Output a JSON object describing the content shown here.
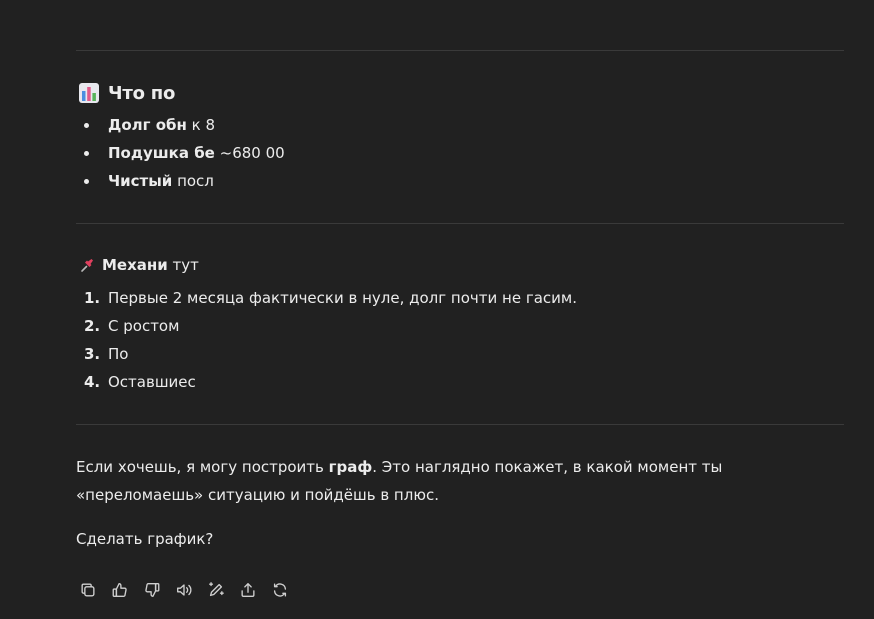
{
  "section1": {
    "heading_icon": "bar-chart-emoji-icon",
    "heading": "Что по",
    "items": [
      {
        "bold": "Долг обн",
        "text": " к 8"
      },
      {
        "bold": "Подушка бе",
        "text": " ~680 00"
      },
      {
        "bold": "Чистый",
        "text": " посл"
      }
    ]
  },
  "section2": {
    "heading_icon": "pushpin-emoji-icon",
    "bold": "Механи",
    "text": " тут",
    "items": [
      {
        "num": "1.",
        "text": "Первые 2 месяца фактически в нуле, долг почти не гасим."
      },
      {
        "num": "2.",
        "text": "С ростом"
      },
      {
        "num": "3.",
        "text": "По"
      },
      {
        "num": "4.",
        "text": "Оставшиес"
      }
    ]
  },
  "closing": {
    "p1_before": "Если хочешь, я могу построить ",
    "p1_bold": "граф",
    "p1_after": ". Это наглядно покажет, в какой момент ты «переломаешь» ситуацию и пойдёшь в плюс.",
    "p2": "Сделать график?"
  },
  "toolbar": {
    "icons": [
      "copy-icon",
      "thumbs-up-icon",
      "thumbs-down-icon",
      "read-aloud-icon",
      "edit-icon",
      "share-icon",
      "regenerate-icon"
    ]
  }
}
